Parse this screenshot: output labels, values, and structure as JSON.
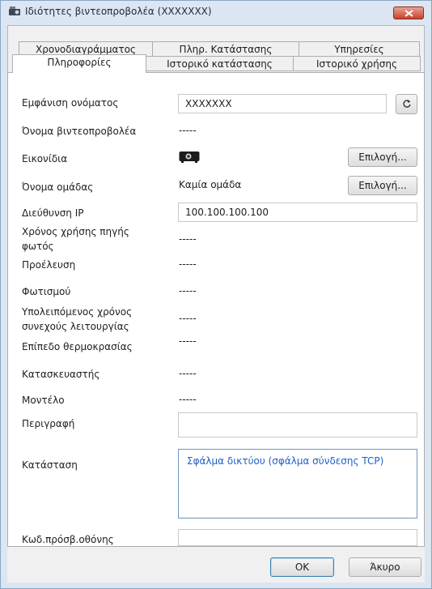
{
  "window": {
    "title": "Ιδιότητες βιντεοπροβολέα (XXXXXXX)"
  },
  "tabs_row1": [
    {
      "label": "Χρονοδιαγράμματος"
    },
    {
      "label": "Πληρ. Κατάστασης"
    },
    {
      "label": "Υπηρεσίες"
    }
  ],
  "tabs_row2": [
    {
      "label": "Πληροφορίες",
      "active": true
    },
    {
      "label": "Ιστορικό κατάστασης"
    },
    {
      "label": "Ιστορικό χρήσης"
    }
  ],
  "info": {
    "display_name": {
      "label": "Εμφάνιση ονόματος",
      "value": "XXXXXXX"
    },
    "projector_name": {
      "label": "Όνομα βιντεοπροβολέα",
      "value": "-----"
    },
    "icons": {
      "label": "Εικονίδια",
      "icon": "projector-icon",
      "button": "Επιλογή..."
    },
    "group_name": {
      "label": "Όνομα ομάδας",
      "value": "Καμία ομάδα",
      "button": "Επιλογή..."
    },
    "ip_address": {
      "label": "Διεύθυνση IP",
      "value": "100.100.100.100"
    },
    "lamp_hours": {
      "label_line1": "Χρόνος χρήσης πηγής",
      "label_line2": "φωτός",
      "value": "-----"
    },
    "source": {
      "label": "Προέλευση",
      "value": "-----"
    },
    "lighting": {
      "label": "Φωτισμού",
      "value": "-----"
    },
    "remaining_time": {
      "label_line1": "Υπολειπόμενος χρόνος",
      "label_line2": "συνεχούς λειτουργίας",
      "value": "-----"
    },
    "temperature": {
      "label": "Επίπεδο θερμοκρασίας",
      "value": "-----"
    },
    "manufacturer": {
      "label": "Κατασκευαστής",
      "value": "-----"
    },
    "model": {
      "label": "Μοντέλο",
      "value": "-----"
    },
    "description": {
      "label": "Περιγραφή",
      "value": ""
    },
    "status": {
      "label": "Κατάσταση",
      "value": "Σφάλμα δικτύου (σφάλμα σύνδεσης TCP)"
    },
    "screen_code": {
      "label": "Κωδ.πρόσβ.οθόνης",
      "value": ""
    }
  },
  "footer": {
    "ok": "OK",
    "cancel": "Άκυρο"
  },
  "colors": {
    "titlebar": "#dbe6f2",
    "close": "#c7432c",
    "status_text": "#2060c8"
  }
}
